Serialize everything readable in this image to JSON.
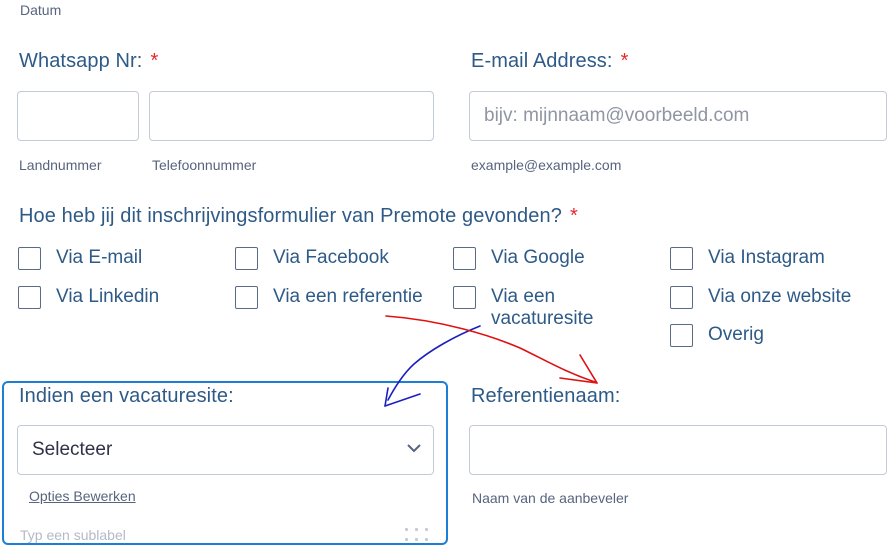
{
  "top_sublabel": "Datum",
  "whatsapp": {
    "label": "Whatsapp Nr:",
    "required": "*",
    "country_value": "",
    "phone_value": "",
    "country_sublabel": "Landnummer",
    "phone_sublabel": "Telefoonnummer"
  },
  "email": {
    "label": "E-mail Address:",
    "required": "*",
    "placeholder": "bijv: mijnnaam@voorbeeld.com",
    "sublabel": "example@example.com"
  },
  "source": {
    "question": "Hoe heb jij dit inschrijvingsformulier van Premote gevonden?",
    "required": "*",
    "options": [
      "Via E-mail",
      "Via Facebook",
      "Via Google",
      "Via Instagram",
      "Via Linkedin",
      "Via een referentie",
      "Via een vacaturesite",
      "Via onze website",
      "Overig"
    ]
  },
  "vacancy_site": {
    "label": "Indien een vacaturesite:",
    "selected": "Selecteer",
    "edit_options_link": "Opties Bewerken",
    "sublabel_placeholder": "Typ een sublabel"
  },
  "reference": {
    "label": "Referentienaam:",
    "value": "",
    "sublabel": "Naam van de aanbeveler"
  },
  "colors": {
    "label": "#2e5a87",
    "required": "#e5282d",
    "selection_border": "#1d7ed6",
    "annotation_blue": "#1a1fc0",
    "annotation_red": "#e01010"
  },
  "icons": {
    "select_chevron": "chevron-down-icon",
    "drag_handle": "drag-handle-icon"
  }
}
